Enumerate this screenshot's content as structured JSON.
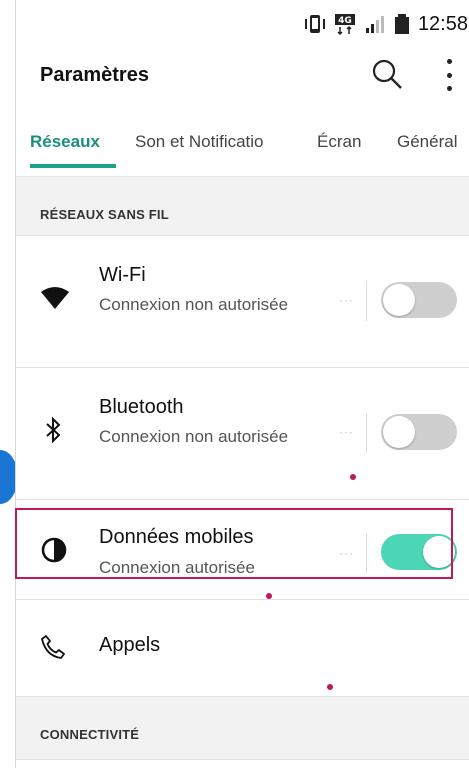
{
  "status": {
    "time": "12:58",
    "network": "4G"
  },
  "appbar": {
    "title": "Paramètres"
  },
  "tabs": [
    {
      "label": "Réseaux"
    },
    {
      "label": "Son et Notificatio"
    },
    {
      "label": "Écran"
    },
    {
      "label": "Général"
    }
  ],
  "sections": {
    "wireless": "RÉSEAUX SANS FIL",
    "connectivity": "CONNECTIVITÉ"
  },
  "items": {
    "wifi": {
      "title": "Wi-Fi",
      "subtitle": "Connexion non autorisée",
      "enabled": false
    },
    "bluetooth": {
      "title": "Bluetooth",
      "subtitle": "Connexion non autorisée",
      "enabled": false
    },
    "mobile_data": {
      "title": "Données mobiles",
      "subtitle": "Connexion autorisée",
      "enabled": true
    },
    "calls": {
      "title": "Appels"
    }
  },
  "colors": {
    "accent": "#1a8f7c",
    "toggle_on": "#4dd6b6",
    "highlight": "#c2185b"
  },
  "dots_glyph": "···"
}
